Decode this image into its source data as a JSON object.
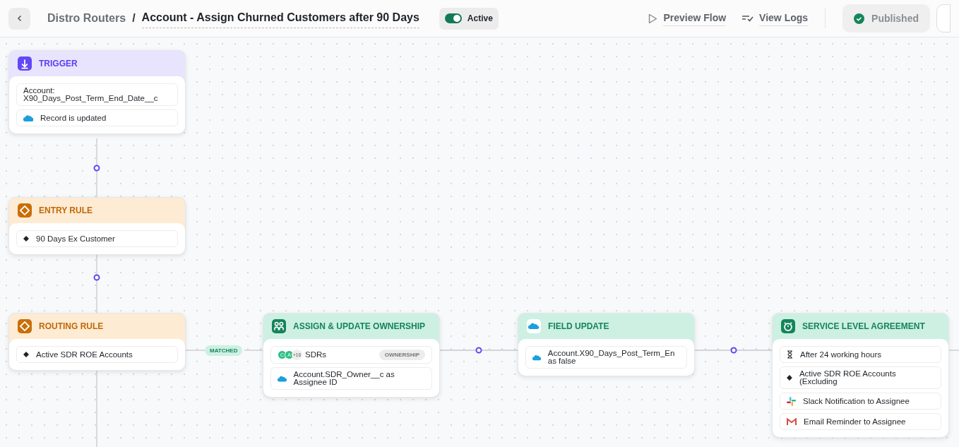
{
  "header": {
    "breadcrumb": "Distro Routers",
    "separator": "/",
    "title": "Account - Assign Churned Customers after 90 Days",
    "toggle": {
      "label": "Active",
      "on": true
    },
    "actions": [
      "Preview Flow",
      "View Logs"
    ],
    "status": "Published"
  },
  "nodes": [
    {
      "kind": "trigger",
      "title": "TRIGGER",
      "items": [
        {
          "kind": "text",
          "text": "Account: X90_Days_Post_Term_End_Date__c"
        },
        {
          "kind": "salesforce",
          "text": "Record is updated"
        }
      ]
    },
    {
      "kind": "rule",
      "title": "ENTRY RULE",
      "items": [
        {
          "kind": "diamond",
          "text": "90 Days Ex Customer"
        }
      ]
    },
    {
      "kind": "rule",
      "title": "ROUTING RULE",
      "items": [
        {
          "kind": "diamond",
          "text": "Active SDR ROE Accounts"
        }
      ]
    },
    {
      "kind": "assign",
      "title": "ASSIGN & UPDATE OWNERSHIP",
      "items": [
        {
          "kind": "owners",
          "avatars": [
            "C",
            "A"
          ],
          "more": "+16",
          "text": "SDRs",
          "badge": "OWNERSHIP"
        },
        {
          "kind": "salesforce",
          "text": "Account.SDR_Owner__c as Assignee ID"
        }
      ]
    },
    {
      "kind": "field",
      "title": "FIELD UPDATE",
      "items": [
        {
          "kind": "salesforce",
          "text": "Account.X90_Days_Post_Term_En as false"
        }
      ]
    },
    {
      "kind": "sla",
      "title": "SERVICE LEVEL AGREEMENT",
      "items": [
        {
          "kind": "hourglass",
          "text": "After 24 working hours"
        },
        {
          "kind": "diamond",
          "text": "Active SDR ROE Accounts (Excluding"
        },
        {
          "kind": "slack",
          "text": "Slack Notification to Assignee"
        },
        {
          "kind": "gmail",
          "text": "Email Reminder to Assignee"
        }
      ]
    }
  ],
  "edge_label": "MATCHED"
}
